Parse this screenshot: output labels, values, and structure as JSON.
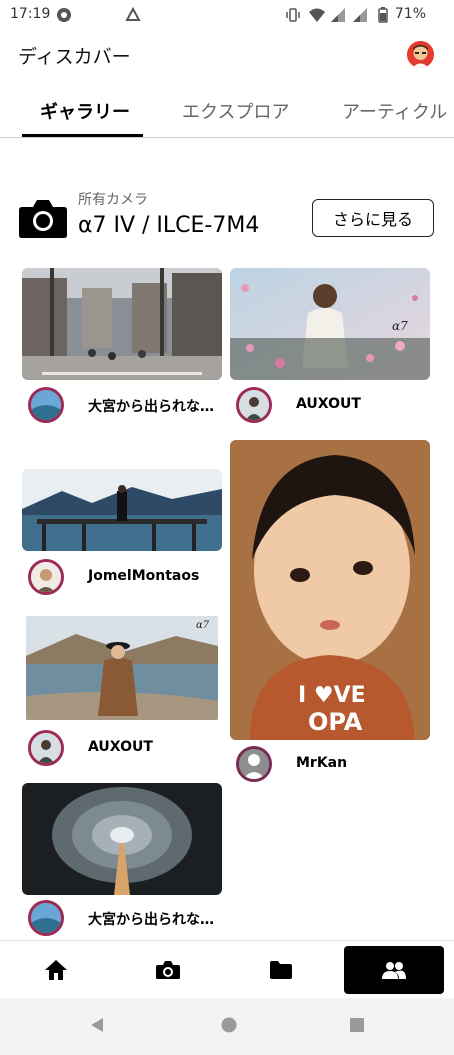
{
  "status": {
    "time": "17:19",
    "battery": "71%"
  },
  "app": {
    "title": "ディスカバー"
  },
  "tabs": [
    {
      "label": "ギャラリー",
      "active": true
    },
    {
      "label": "エクスプロア",
      "active": false
    },
    {
      "label": "アーティクル",
      "active": false
    }
  ],
  "camera": {
    "subtitle": "所有カメラ",
    "name": "α7 IV / ILCE-7M4",
    "more_label": "さらに見る"
  },
  "posts": [
    {
      "user": "大宮から出られな…"
    },
    {
      "user": "AUXOUT"
    },
    {
      "user": "JomelMontaos"
    },
    {
      "user": "MrKan"
    },
    {
      "user": "AUXOUT"
    },
    {
      "user": "大宮から出られな…"
    }
  ],
  "watermark": "α7",
  "bottom_nav": [
    "home-icon",
    "camera-icon",
    "folder-icon",
    "community-icon"
  ],
  "colors": {
    "accent": "#000000",
    "avatar_ring": "#9c2b57"
  }
}
